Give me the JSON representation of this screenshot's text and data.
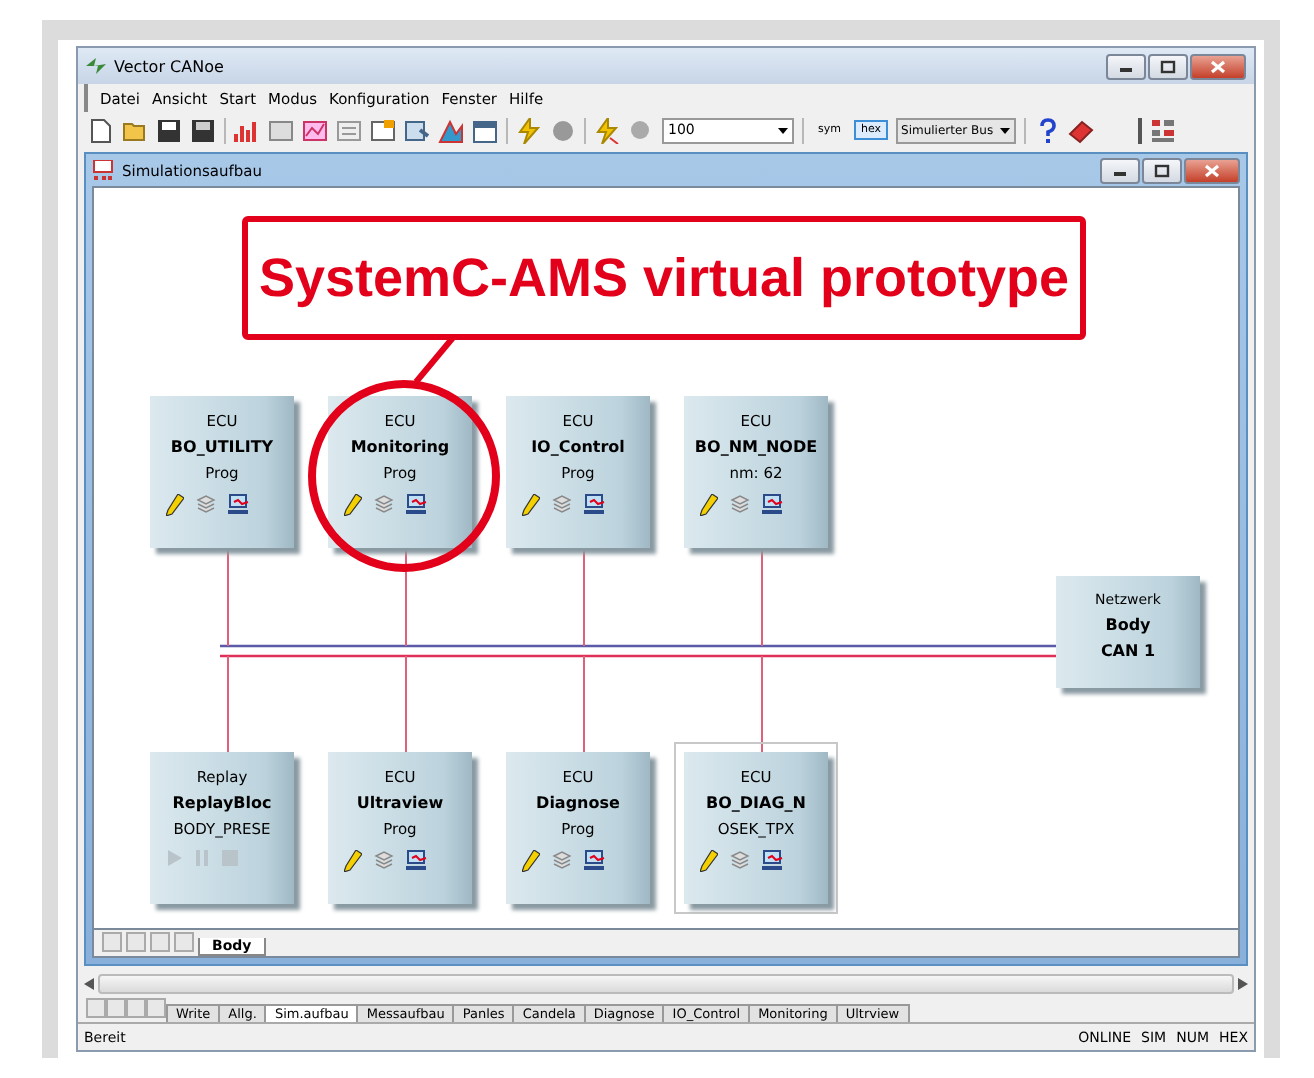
{
  "window": {
    "title": "Vector CANoe"
  },
  "menu": [
    "Datei",
    "Ansicht",
    "Start",
    "Modus",
    "Konfiguration",
    "Fenster",
    "Hilfe"
  ],
  "toolbar": {
    "zoom": "100",
    "format_buttons": [
      {
        "label": "sym",
        "selected": false
      },
      {
        "label": "hex",
        "selected": true
      }
    ],
    "bus_mode": "Simulierter Bus"
  },
  "child_window": {
    "title": "Simulationsaufbau"
  },
  "callout": {
    "text": "SystemC-AMS virtual prototype"
  },
  "node_rows": [
    {
      "nodes": [
        {
          "kind": "ecu",
          "type": "ECU",
          "name": "BO_UTILITY",
          "sub": "Prog",
          "circled": false,
          "selected": false
        },
        {
          "kind": "ecu",
          "type": "ECU",
          "name": "Monitoring",
          "sub": "Prog",
          "circled": true,
          "selected": false
        },
        {
          "kind": "ecu",
          "type": "ECU",
          "name": "IO_Control",
          "sub": "Prog",
          "circled": false,
          "selected": false
        },
        {
          "kind": "ecu",
          "type": "ECU",
          "name": "BO_NM_NODE",
          "sub": "nm: 62",
          "circled": false,
          "selected": false
        }
      ]
    },
    {
      "nodes": [
        {
          "kind": "replay",
          "type": "Replay",
          "name": "ReplayBloc",
          "sub": "BODY_PRESE",
          "circled": false,
          "selected": false
        },
        {
          "kind": "ecu",
          "type": "ECU",
          "name": "Ultraview",
          "sub": "Prog",
          "circled": false,
          "selected": false
        },
        {
          "kind": "ecu",
          "type": "ECU",
          "name": "Diagnose",
          "sub": "Prog",
          "circled": false,
          "selected": false
        },
        {
          "kind": "ecu",
          "type": "ECU",
          "name": "BO_DIAG_N",
          "sub": "OSEK_TPX",
          "circled": false,
          "selected": true
        }
      ]
    }
  ],
  "network": {
    "type": "Netzwerk",
    "name": "Body",
    "sub": "CAN 1"
  },
  "page_tabs": [
    {
      "label": "Body",
      "selected": true
    }
  ],
  "sheet_tabs": [
    {
      "label": "Write",
      "selected": false
    },
    {
      "label": "Allg.",
      "selected": false
    },
    {
      "label": "Sim.aufbau",
      "selected": true
    },
    {
      "label": "Messaufbau",
      "selected": false
    },
    {
      "label": "Panles",
      "selected": false
    },
    {
      "label": "Candela",
      "selected": false
    },
    {
      "label": "Diagnose",
      "selected": false
    },
    {
      "label": "IO_Control",
      "selected": false
    },
    {
      "label": "Monitoring",
      "selected": false
    },
    {
      "label": "Ultrview",
      "selected": false
    }
  ],
  "status_bar": {
    "text": "Bereit",
    "indicators": [
      "ONLINE",
      "SIM",
      "NUM",
      "HEX"
    ]
  }
}
